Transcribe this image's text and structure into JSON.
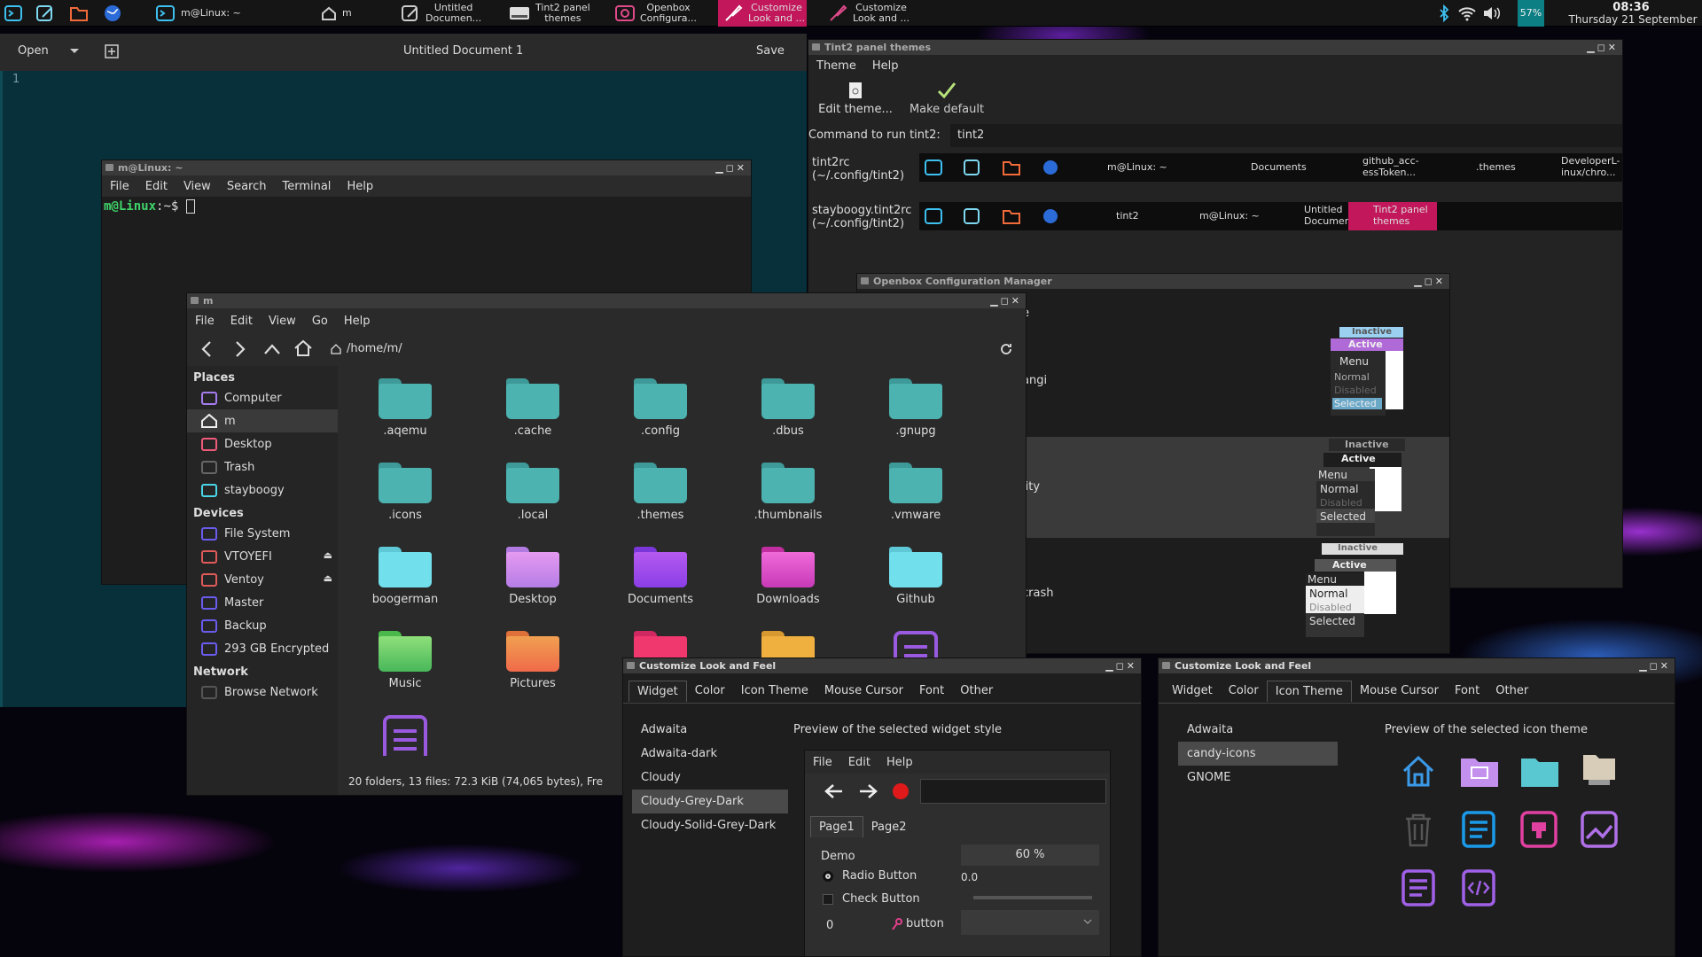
{
  "taskbar": {
    "items": [
      {
        "label": "m@Linux: ~"
      },
      {
        "label": "m"
      },
      {
        "label": "Untitled\nDocumen..."
      },
      {
        "label": "Tint2 panel\nthemes"
      },
      {
        "label": "Openbox\nConfigura..."
      },
      {
        "label": "Customize\nLook and ..."
      },
      {
        "label": "Customize\nLook and ..."
      }
    ],
    "battery": "57%",
    "time": "08:36",
    "date": "Thursday 21 September"
  },
  "editor": {
    "open": "Open",
    "title": "Untitled Document 1",
    "save": "Save",
    "line": "1"
  },
  "terminal": {
    "title": "m@Linux: ~",
    "menu": [
      "File",
      "Edit",
      "View",
      "Search",
      "Terminal",
      "Help"
    ],
    "prompt_user": "m@Linux",
    "prompt_rest": ":~$ "
  },
  "files": {
    "title": "m",
    "menu": [
      "File",
      "Edit",
      "View",
      "Go",
      "Help"
    ],
    "path": "/home/m/",
    "places_header": "Places",
    "devices_header": "Devices",
    "network_header": "Network",
    "places": [
      "Computer",
      "m",
      "Desktop",
      "Trash",
      "stayboogy"
    ],
    "devices": [
      "File System",
      "VTOYEFI",
      "Ventoy",
      "Master",
      "Backup",
      "293 GB Encrypted"
    ],
    "network": [
      "Browse Network"
    ],
    "items": [
      ".aqemu",
      ".cache",
      ".config",
      ".dbus",
      ".gnupg",
      ".icons",
      ".local",
      ".themes",
      ".thumbnails",
      ".vmware",
      "boogerman",
      "Desktop",
      "Documents",
      "Downloads",
      "Github",
      "Music",
      "Pictures",
      "",
      ""
    ],
    "status": "20 folders, 13 files: 72.3 KiB (74,065 bytes), Fre"
  },
  "tint2": {
    "title": "Tint2 panel themes",
    "menu": [
      "Theme",
      "Help"
    ],
    "edit": "Edit theme...",
    "default": "Make default",
    "cmd_label": "Command to run tint2:",
    "cmd_value": "tint2",
    "theme1_name": "tint2rc\n(~/.config/tint2)",
    "theme2_name": "stayboogy.tint2rc\n(~/.config/tint2)",
    "theme1_tasks": [
      "m@Linux: ~",
      "Documents",
      "github_acc-\nessToken...",
      ".themes",
      "DeveloperL-\ninux/chro..."
    ],
    "theme2_tasks": [
      "tint2",
      "m@Linux: ~",
      "Untitled\nDocumen...",
      "Tint2 panel\nthemes"
    ]
  },
  "openbox": {
    "title": "Openbox Configuration Manager",
    "frag1": "e",
    "frag2": "angi",
    "frag3": "lity",
    "frag4": "crash",
    "prev": {
      "inactive": "Inactive",
      "active": "Active",
      "menu": "Menu",
      "normal": "Normal",
      "disabled": "Disabled",
      "selected": "Selected"
    }
  },
  "lxa1": {
    "title": "Customize Look and Feel",
    "tabs": [
      "Widget",
      "Color",
      "Icon Theme",
      "Mouse Cursor",
      "Font",
      "Other"
    ],
    "themes": [
      "Adwaita",
      "Adwaita-dark",
      "Cloudy",
      "Cloudy-Grey-Dark",
      "Cloudy-Solid-Grey-Dark"
    ],
    "preview_title": "Preview of the selected widget style",
    "pmenu": [
      "File",
      "Edit",
      "Help"
    ],
    "ptabs": [
      "Page1",
      "Page2"
    ],
    "demo": "Demo",
    "radio": "Radio Button",
    "check": "Check Button",
    "progress": "60 %",
    "scale": "0.0",
    "spin": "0",
    "button": "button"
  },
  "lxa2": {
    "title": "Customize Look and Feel",
    "tabs": [
      "Widget",
      "Color",
      "Icon Theme",
      "Mouse Cursor",
      "Font",
      "Other"
    ],
    "themes": [
      "Adwaita",
      "candy-icons",
      "GNOME"
    ],
    "preview_title": "Preview of the selected icon theme"
  }
}
